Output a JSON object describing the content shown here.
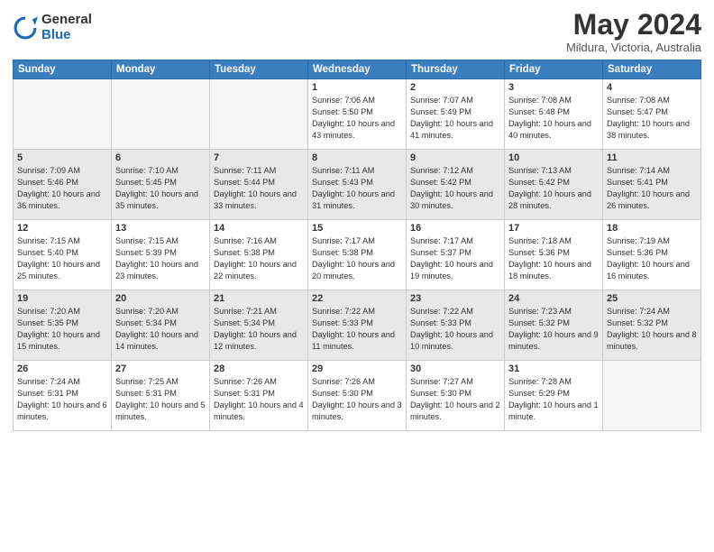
{
  "header": {
    "logo_general": "General",
    "logo_blue": "Blue",
    "month_year": "May 2024",
    "location": "Mildura, Victoria, Australia"
  },
  "days_of_week": [
    "Sunday",
    "Monday",
    "Tuesday",
    "Wednesday",
    "Thursday",
    "Friday",
    "Saturday"
  ],
  "weeks": [
    [
      {
        "day": "",
        "empty": true
      },
      {
        "day": "",
        "empty": true
      },
      {
        "day": "",
        "empty": true
      },
      {
        "day": "1",
        "sunrise": "7:06 AM",
        "sunset": "5:50 PM",
        "daylight": "10 hours and 43 minutes."
      },
      {
        "day": "2",
        "sunrise": "7:07 AM",
        "sunset": "5:49 PM",
        "daylight": "10 hours and 41 minutes."
      },
      {
        "day": "3",
        "sunrise": "7:08 AM",
        "sunset": "5:48 PM",
        "daylight": "10 hours and 40 minutes."
      },
      {
        "day": "4",
        "sunrise": "7:08 AM",
        "sunset": "5:47 PM",
        "daylight": "10 hours and 38 minutes."
      }
    ],
    [
      {
        "day": "5",
        "sunrise": "7:09 AM",
        "sunset": "5:46 PM",
        "daylight": "10 hours and 36 minutes."
      },
      {
        "day": "6",
        "sunrise": "7:10 AM",
        "sunset": "5:45 PM",
        "daylight": "10 hours and 35 minutes."
      },
      {
        "day": "7",
        "sunrise": "7:11 AM",
        "sunset": "5:44 PM",
        "daylight": "10 hours and 33 minutes."
      },
      {
        "day": "8",
        "sunrise": "7:11 AM",
        "sunset": "5:43 PM",
        "daylight": "10 hours and 31 minutes."
      },
      {
        "day": "9",
        "sunrise": "7:12 AM",
        "sunset": "5:42 PM",
        "daylight": "10 hours and 30 minutes."
      },
      {
        "day": "10",
        "sunrise": "7:13 AM",
        "sunset": "5:42 PM",
        "daylight": "10 hours and 28 minutes."
      },
      {
        "day": "11",
        "sunrise": "7:14 AM",
        "sunset": "5:41 PM",
        "daylight": "10 hours and 26 minutes."
      }
    ],
    [
      {
        "day": "12",
        "sunrise": "7:15 AM",
        "sunset": "5:40 PM",
        "daylight": "10 hours and 25 minutes."
      },
      {
        "day": "13",
        "sunrise": "7:15 AM",
        "sunset": "5:39 PM",
        "daylight": "10 hours and 23 minutes."
      },
      {
        "day": "14",
        "sunrise": "7:16 AM",
        "sunset": "5:38 PM",
        "daylight": "10 hours and 22 minutes."
      },
      {
        "day": "15",
        "sunrise": "7:17 AM",
        "sunset": "5:38 PM",
        "daylight": "10 hours and 20 minutes."
      },
      {
        "day": "16",
        "sunrise": "7:17 AM",
        "sunset": "5:37 PM",
        "daylight": "10 hours and 19 minutes."
      },
      {
        "day": "17",
        "sunrise": "7:18 AM",
        "sunset": "5:36 PM",
        "daylight": "10 hours and 18 minutes."
      },
      {
        "day": "18",
        "sunrise": "7:19 AM",
        "sunset": "5:36 PM",
        "daylight": "10 hours and 16 minutes."
      }
    ],
    [
      {
        "day": "19",
        "sunrise": "7:20 AM",
        "sunset": "5:35 PM",
        "daylight": "10 hours and 15 minutes."
      },
      {
        "day": "20",
        "sunrise": "7:20 AM",
        "sunset": "5:34 PM",
        "daylight": "10 hours and 14 minutes."
      },
      {
        "day": "21",
        "sunrise": "7:21 AM",
        "sunset": "5:34 PM",
        "daylight": "10 hours and 12 minutes."
      },
      {
        "day": "22",
        "sunrise": "7:22 AM",
        "sunset": "5:33 PM",
        "daylight": "10 hours and 11 minutes."
      },
      {
        "day": "23",
        "sunrise": "7:22 AM",
        "sunset": "5:33 PM",
        "daylight": "10 hours and 10 minutes."
      },
      {
        "day": "24",
        "sunrise": "7:23 AM",
        "sunset": "5:32 PM",
        "daylight": "10 hours and 9 minutes."
      },
      {
        "day": "25",
        "sunrise": "7:24 AM",
        "sunset": "5:32 PM",
        "daylight": "10 hours and 8 minutes."
      }
    ],
    [
      {
        "day": "26",
        "sunrise": "7:24 AM",
        "sunset": "5:31 PM",
        "daylight": "10 hours and 6 minutes."
      },
      {
        "day": "27",
        "sunrise": "7:25 AM",
        "sunset": "5:31 PM",
        "daylight": "10 hours and 5 minutes."
      },
      {
        "day": "28",
        "sunrise": "7:26 AM",
        "sunset": "5:31 PM",
        "daylight": "10 hours and 4 minutes."
      },
      {
        "day": "29",
        "sunrise": "7:26 AM",
        "sunset": "5:30 PM",
        "daylight": "10 hours and 3 minutes."
      },
      {
        "day": "30",
        "sunrise": "7:27 AM",
        "sunset": "5:30 PM",
        "daylight": "10 hours and 2 minutes."
      },
      {
        "day": "31",
        "sunrise": "7:28 AM",
        "sunset": "5:29 PM",
        "daylight": "10 hours and 1 minute."
      },
      {
        "day": "",
        "empty": true
      }
    ]
  ],
  "labels": {
    "sunrise": "Sunrise:",
    "sunset": "Sunset:",
    "daylight": "Daylight:"
  }
}
